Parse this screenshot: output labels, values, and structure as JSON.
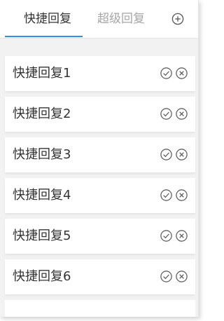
{
  "tabs": {
    "quick_reply": "快捷回复",
    "super_reply": "超级回复"
  },
  "colors": {
    "accent": "#2f8fe8",
    "active_tab_text": "#333333",
    "inactive_tab_text": "#a6a6a6"
  },
  "items": [
    {
      "label": "快捷回复1"
    },
    {
      "label": "快捷回复2"
    },
    {
      "label": "快捷回复3"
    },
    {
      "label": "快捷回复4"
    },
    {
      "label": "快捷回复5"
    },
    {
      "label": "快捷回复6"
    }
  ]
}
